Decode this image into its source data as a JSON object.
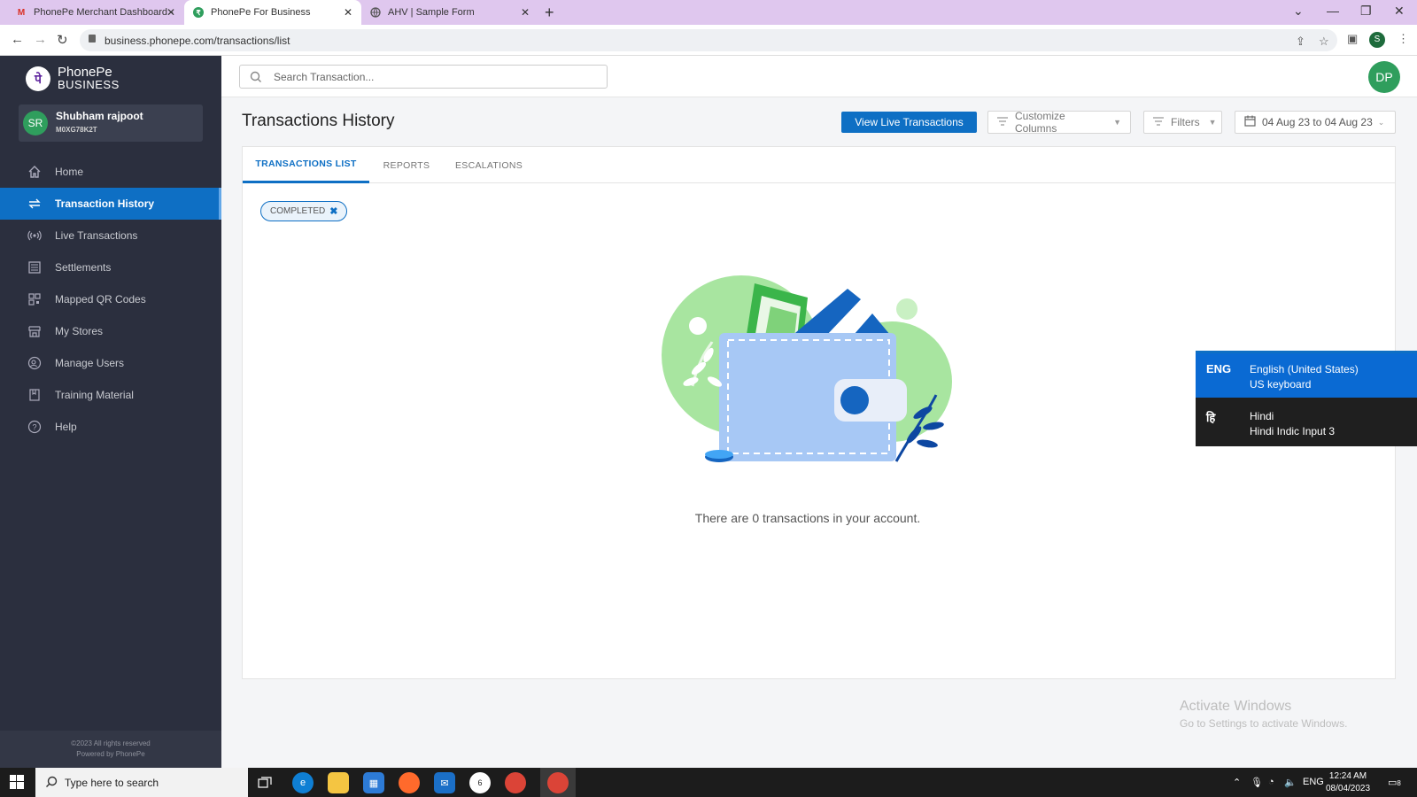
{
  "browser": {
    "tabs": [
      {
        "title": "PhonePe Merchant Dashboard - ",
        "icon": "gmail-icon"
      },
      {
        "title": "PhonePe For Business",
        "icon": "phonepe-icon"
      },
      {
        "title": "AHV | Sample Form",
        "icon": "globe-icon"
      }
    ],
    "url": "business.phonepe.com/transactions/list",
    "profile_initial": "S"
  },
  "sidebar": {
    "brand_line1": "PhonePe",
    "brand_line2": "BUSINESS",
    "user": {
      "initials": "SR",
      "name": "Shubham rajpoot",
      "id": "M0XG78K2T"
    },
    "items": [
      {
        "label": "Home",
        "icon": "home-icon",
        "active": false
      },
      {
        "label": "Transaction History",
        "icon": "transactions-icon",
        "active": true
      },
      {
        "label": "Live Transactions",
        "icon": "broadcast-icon",
        "active": false
      },
      {
        "label": "Settlements",
        "icon": "list-icon",
        "active": false
      },
      {
        "label": "Mapped QR Codes",
        "icon": "qr-code-icon",
        "active": false
      },
      {
        "label": "My Stores",
        "icon": "store-icon",
        "active": false
      },
      {
        "label": "Manage Users",
        "icon": "users-icon",
        "active": false
      },
      {
        "label": "Training Material",
        "icon": "book-icon",
        "active": false
      },
      {
        "label": "Help",
        "icon": "help-icon",
        "active": false
      }
    ],
    "footer_line1": "©2023 All rights reserved",
    "footer_line2": "Powered by PhonePe"
  },
  "topbar": {
    "search_placeholder": "Search Transaction...",
    "avatar_initials": "DP"
  },
  "main": {
    "title": "Transactions History",
    "view_live_label": "View Live Transactions",
    "customize_columns_label": "Customize Columns",
    "filters_label": "Filters",
    "date_range": "04 Aug 23 to 04 Aug 23",
    "tabs": [
      {
        "label": "TRANSACTIONS LIST",
        "active": true
      },
      {
        "label": "REPORTS",
        "active": false
      },
      {
        "label": "ESCALATIONS",
        "active": false
      }
    ],
    "filter_chip": "COMPLETED",
    "empty_message": "There are 0 transactions in your account."
  },
  "watermark": {
    "line1": "Activate Windows",
    "line2": "Go to Settings to activate Windows."
  },
  "language_popup": {
    "options": [
      {
        "code": "ENG",
        "name": "English (United States)",
        "keyboard": "US keyboard",
        "selected": true
      },
      {
        "code": "हि",
        "name": "Hindi",
        "keyboard": "Hindi Indic Input 3",
        "selected": false
      }
    ]
  },
  "taskbar": {
    "search_placeholder": "Type here to search",
    "lang": "ENG",
    "time": "12:24 AM",
    "date": "08/04/2023",
    "notification_count": "8",
    "whatsapp_badge": "6"
  },
  "colors": {
    "primary": "#0e6fc4",
    "sidebar_bg": "#2b2f3e",
    "avatar_green": "#2f9e5d",
    "tabbar": "#dfc7ee"
  }
}
